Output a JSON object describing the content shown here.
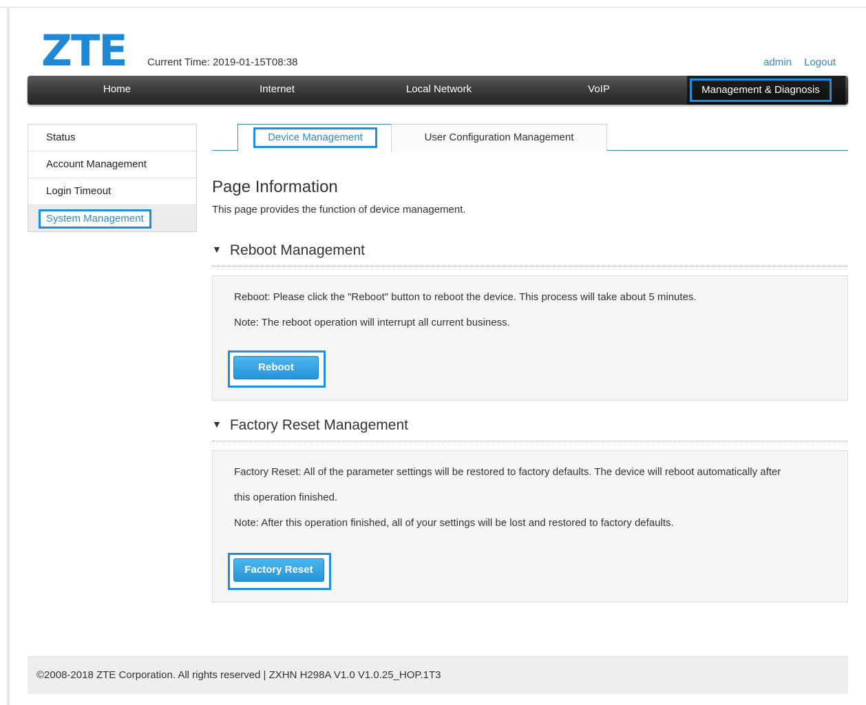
{
  "header": {
    "logo": "ZTE",
    "current_time": "Current Time: 2019-01-15T08:38",
    "user": "admin",
    "logout": "Logout"
  },
  "nav": {
    "items": [
      "Home",
      "Internet",
      "Local Network",
      "VoIP",
      "Management & Diagnosis"
    ],
    "active": "Management & Diagnosis"
  },
  "sidebar": {
    "items": [
      "Status",
      "Account Management",
      "Login Timeout",
      "System Management"
    ],
    "active": "System Management"
  },
  "tabs": {
    "items": [
      "Device Management",
      "User Configuration Management"
    ],
    "active": "Device Management"
  },
  "page": {
    "title": "Page Information",
    "description": "This page provides the function of device management."
  },
  "reboot": {
    "title": "Reboot Management",
    "text1": "Reboot: Please click the \"Reboot\" button to reboot the device. This process will take about 5 minutes.",
    "text2": "Note: The reboot operation will interrupt all current business.",
    "button": "Reboot"
  },
  "factory": {
    "title": "Factory Reset Management",
    "text1": "Factory Reset: All of the parameter settings will be restored to factory defaults. The device will reboot automatically after",
    "text1b": "this operation finished.",
    "text2": "Note: After this operation finished, all of your settings will be lost and restored to factory defaults.",
    "button": "Factory Reset"
  },
  "footer": {
    "text": "©2008-2018 ZTE Corporation. All rights reserved  |   ZXHN H298A V1.0 V1.0.25_HOP.1T3"
  },
  "colors": {
    "accent": "#1c8fe0",
    "link": "#2f8ad0",
    "button": "#2594d8",
    "navbar": "#3a3a3a"
  }
}
